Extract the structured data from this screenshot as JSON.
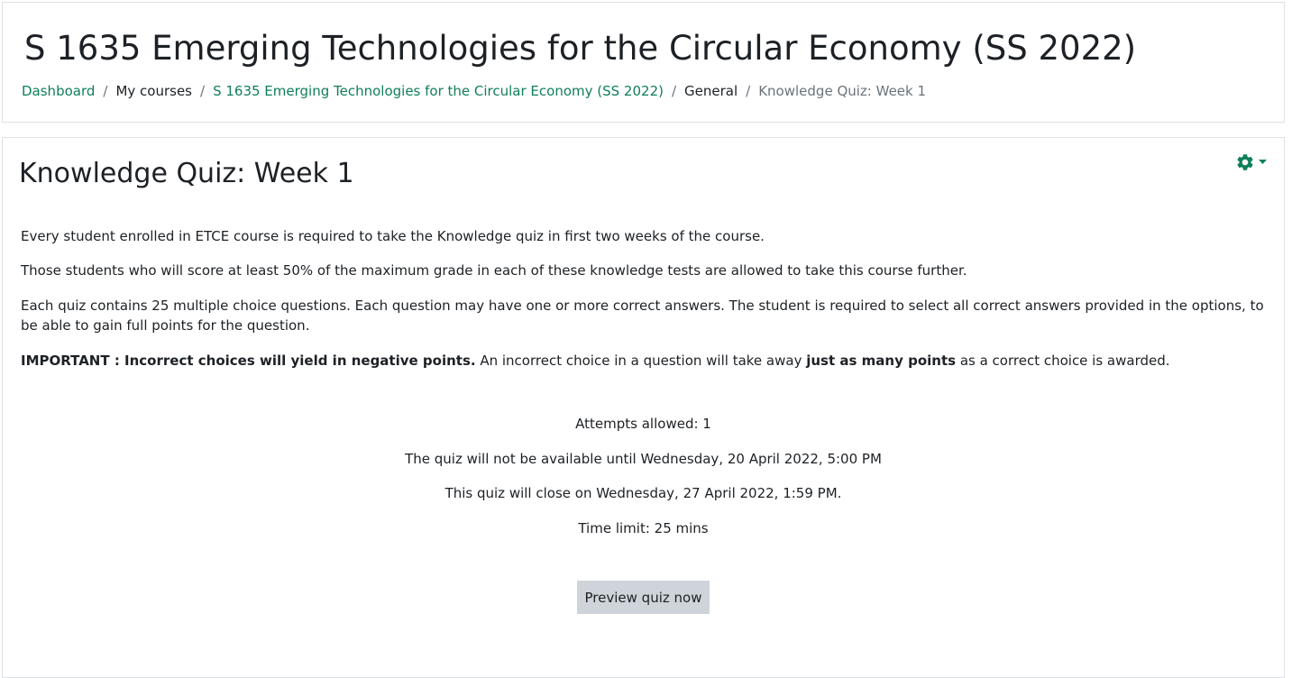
{
  "header": {
    "course_title": "S 1635 Emerging Technologies for the Circular Economy (SS 2022)",
    "breadcrumb": [
      {
        "label": "Dashboard"
      },
      {
        "label": "My courses"
      },
      {
        "label": "S 1635 Emerging Technologies for the Circular Economy (SS 2022)"
      },
      {
        "label": "General"
      },
      {
        "label": "Knowledge Quiz: Week 1"
      }
    ],
    "separator": "/"
  },
  "quiz": {
    "title": "Knowledge Quiz: Week 1",
    "settings_icon": "gear-icon",
    "intro": {
      "p1": "Every student enrolled in ETCE course is required to take the Knowledge quiz in first two weeks of the course.",
      "p2": "Those students who will score at least 50% of the maximum grade in each of these knowledge tests are allowed to take this course further.",
      "p3": "Each quiz contains 25 multiple choice questions. Each question may have one or more correct answers. The student is required to select all correct answers provided in the options, to be able to gain full points for the question.",
      "p4_bold": "IMPORTANT : Incorrect choices will yield in negative points.",
      "p4_mid": " An incorrect choice in a question will take away ",
      "p4_bold2": "just as many points",
      "p4_end": " as a correct choice is awarded."
    },
    "info": {
      "attempts": "Attempts allowed: 1",
      "open": "The quiz will not be available until Wednesday, 20 April 2022, 5:00 PM",
      "close": "This quiz will close on Wednesday, 27 April 2022, 1:59 PM.",
      "time_limit": "Time limit: 25 mins"
    },
    "preview_button": "Preview quiz now"
  },
  "colors": {
    "link": "#0f7f5a",
    "button_bg": "#ced4da",
    "border": "#dee2e6"
  }
}
